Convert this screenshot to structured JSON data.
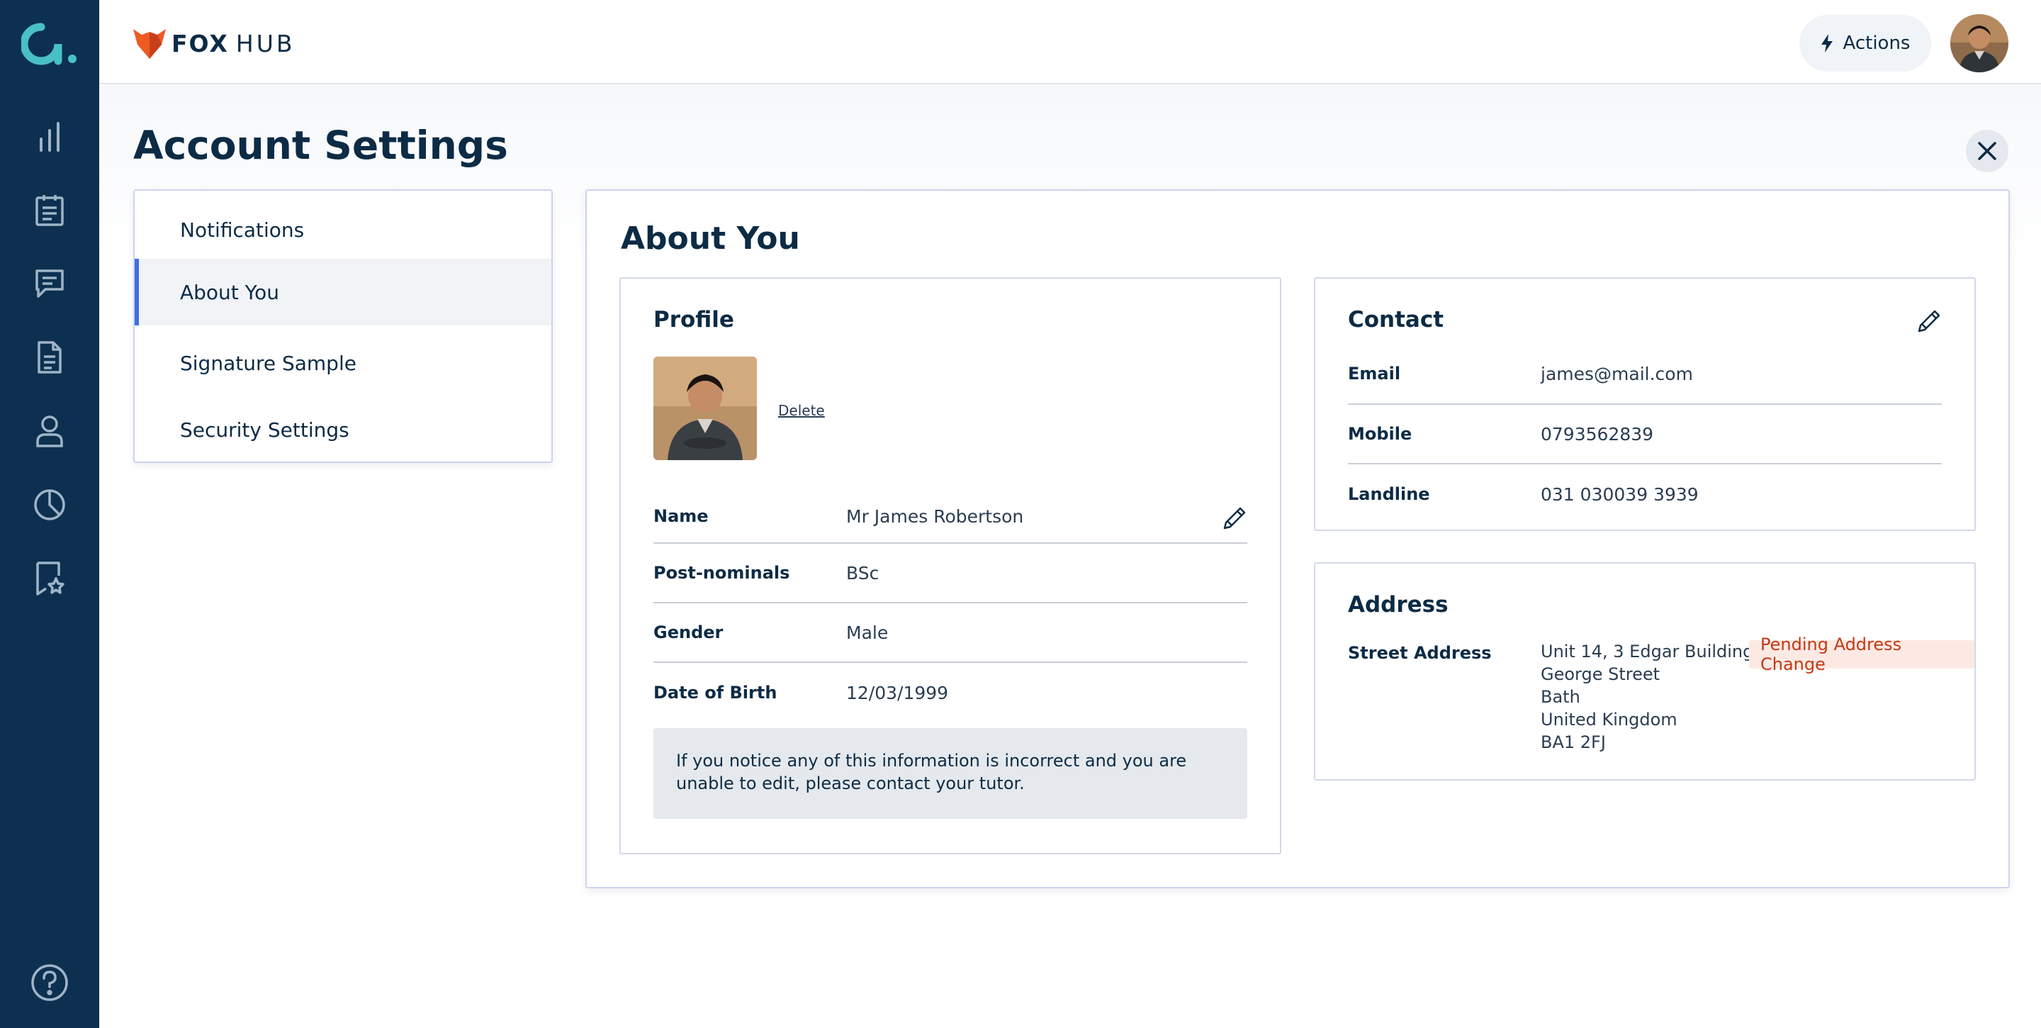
{
  "brand": {
    "name_bold": "FOX",
    "name_light": "HUB"
  },
  "header": {
    "actions_label": "Actions"
  },
  "page": {
    "title": "Account Settings"
  },
  "menu": {
    "items": [
      {
        "label": "Notifications"
      },
      {
        "label": "About You"
      },
      {
        "label": "Signature Sample"
      },
      {
        "label": "Security Settings"
      }
    ]
  },
  "about": {
    "title": "About You",
    "profile": {
      "title": "Profile",
      "delete_label": "Delete",
      "fields": [
        {
          "label": "Name",
          "value": "Mr James Robertson"
        },
        {
          "label": "Post-nominals",
          "value": "BSc"
        },
        {
          "label": "Gender",
          "value": "Male"
        },
        {
          "label": "Date of Birth",
          "value": "12/03/1999"
        }
      ],
      "notice": "If you notice any of this information is incorrect and you are unable to edit, please contact your tutor."
    },
    "contact": {
      "title": "Contact",
      "fields": [
        {
          "label": "Email",
          "value": "james@mail.com"
        },
        {
          "label": "Mobile",
          "value": "0793562839"
        },
        {
          "label": "Landline",
          "value": "031 030039 3939"
        }
      ]
    },
    "address": {
      "title": "Address",
      "label": "Street Address",
      "lines": [
        "Unit 14, 3 Edgar Buildings",
        "George Street",
        "Bath",
        "United Kingdom",
        "BA1 2FJ"
      ],
      "badge": "Pending Address Change"
    }
  },
  "colors": {
    "rail": "#0d3050",
    "accent_teal": "#49c0c3",
    "active_indicator": "#3d6fe0",
    "badge_text": "#c23a14",
    "badge_bg": "#fde9e4",
    "fox_orange": "#ee5a24"
  },
  "icons": {
    "rail": [
      "logo-icon",
      "bar-chart-icon",
      "clipboard-icon",
      "chat-icon",
      "document-icon",
      "user-icon",
      "pie-chart-icon",
      "bookmark-star-icon",
      "help-icon"
    ],
    "header": [
      "fox-logo-icon",
      "lightning-icon",
      "close-icon"
    ],
    "cards": [
      "pencil-icon"
    ]
  }
}
